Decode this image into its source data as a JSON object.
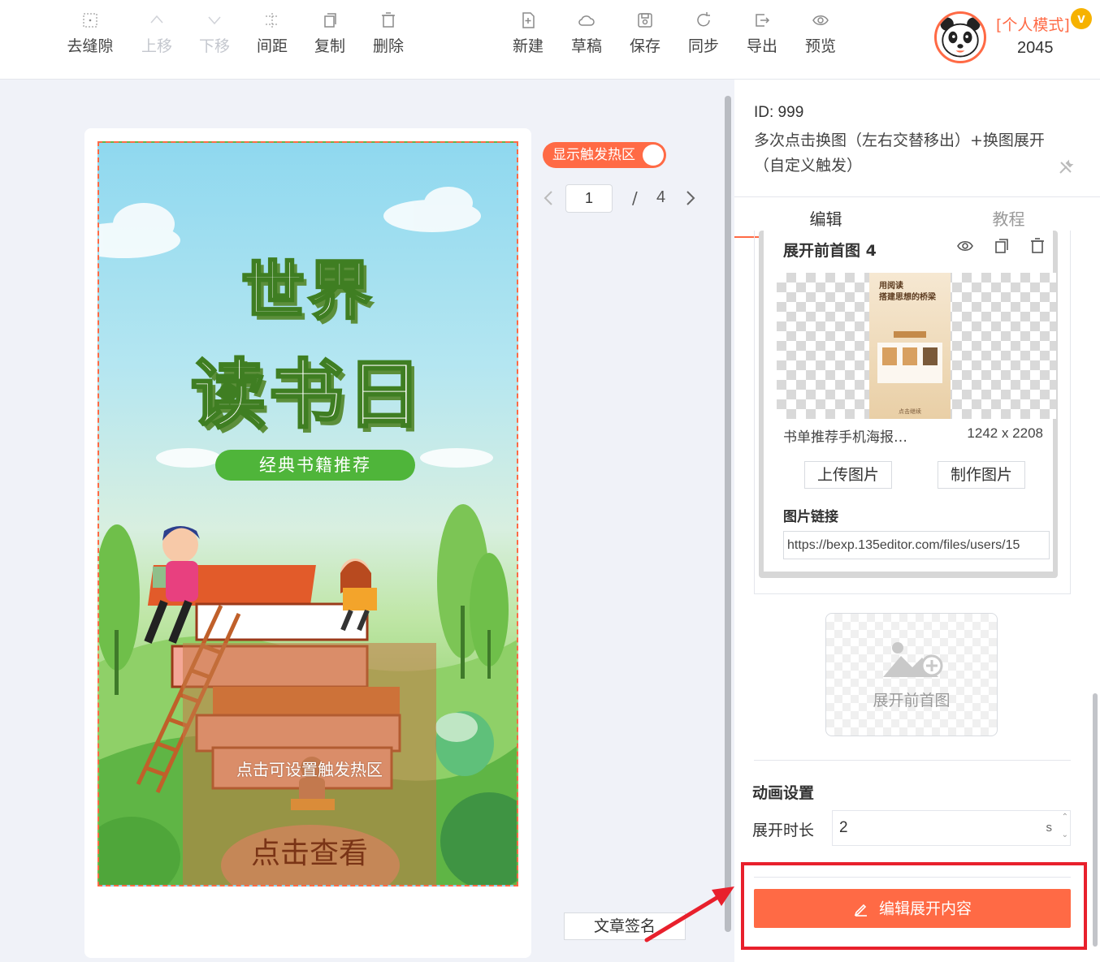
{
  "toolbar": {
    "left_tools": [
      {
        "label": "去缝隙",
        "icon": "grid-dots-icon",
        "disabled": false
      },
      {
        "label": "上移",
        "icon": "chevron-up-icon",
        "disabled": true
      },
      {
        "label": "下移",
        "icon": "chevron-down-icon",
        "disabled": true
      },
      {
        "label": "间距",
        "icon": "spacing-icon",
        "disabled": false
      },
      {
        "label": "复制",
        "icon": "copy-icon",
        "disabled": false
      },
      {
        "label": "删除",
        "icon": "trash-icon",
        "disabled": false
      }
    ],
    "right_tools": [
      {
        "label": "新建",
        "icon": "new-file-icon"
      },
      {
        "label": "草稿",
        "icon": "cloud-icon"
      },
      {
        "label": "保存",
        "icon": "save-icon"
      },
      {
        "label": "同步",
        "icon": "sync-icon"
      },
      {
        "label": "导出",
        "icon": "export-icon"
      },
      {
        "label": "预览",
        "icon": "eye-icon"
      }
    ]
  },
  "user": {
    "mode": "[个人模式]",
    "vip_badge": "v",
    "count": "2045",
    "avatar_icon": "panda-avatar-icon"
  },
  "canvas": {
    "poster_title_line1": "世界",
    "poster_title_line2": "读书日",
    "poster_subtitle": "经典书籍推荐",
    "hotzone_tip": "点击可设置触发热区",
    "hotzone_cta": "点击查看",
    "toggle_label": "显示触发热区",
    "toggle_on": true,
    "page_current": "1",
    "page_separator": "/",
    "page_total": "4",
    "sign_button": "文章签名"
  },
  "panel": {
    "id_text": "ID: 999",
    "description": "多次点击换图（左右交替移出）+换图展开（自定义触发）",
    "tabs": [
      {
        "label": "编辑",
        "active": true
      },
      {
        "label": "教程",
        "active": false
      }
    ],
    "image_card": {
      "title": "展开前首图 4",
      "preview_title": "用阅读\n搭建思想的桥梁",
      "preview_footer": "点击继续",
      "file_name": "书单推荐手机海报…",
      "file_dims": "1242 x 2208",
      "upload_button": "上传图片",
      "make_button": "制作图片",
      "link_label": "图片链接",
      "link_value": "https://bexp.135editor.com/files/users/15"
    },
    "add_image_label": "展开前首图",
    "animation": {
      "section_title": "动画设置",
      "duration_label": "展开时长",
      "duration_value": "2",
      "duration_unit": "s"
    },
    "edit_button": "编辑展开内容"
  },
  "colors": {
    "accent": "#ff6a45",
    "highlight": "#e8202c",
    "poster_green": "#4fb53a"
  }
}
